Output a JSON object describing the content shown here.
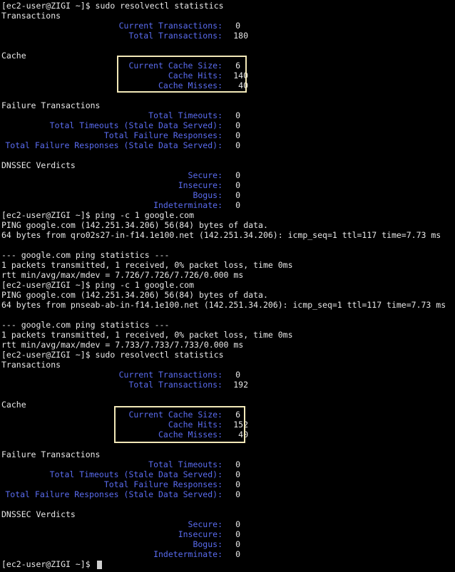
{
  "session1": {
    "prompt": "[ec2-user@ZIGI ~]$ sudo resolvectl statistics",
    "transactions": {
      "heading": "Transactions",
      "rows": [
        {
          "label": "Current Transactions:",
          "value": "0"
        },
        {
          "label": "Total Transactions:",
          "value": "180"
        }
      ]
    },
    "cache": {
      "heading": "Cache",
      "rows": [
        {
          "label": "Current Cache Size:",
          "value": "6"
        },
        {
          "label": "Cache Hits:",
          "value": "140"
        },
        {
          "label": "Cache Misses:",
          "value": "40"
        }
      ]
    },
    "failure": {
      "heading": "Failure Transactions",
      "rows": [
        {
          "label": "Total Timeouts:",
          "value": "0"
        },
        {
          "label": "Total Timeouts (Stale Data Served):",
          "value": "0"
        },
        {
          "label": "Total Failure Responses:",
          "value": "0"
        },
        {
          "label": "Total Failure Responses (Stale Data Served):",
          "value": "0"
        }
      ]
    },
    "dnssec": {
      "heading": "DNSSEC Verdicts",
      "rows": [
        {
          "label": "Secure:",
          "value": "0"
        },
        {
          "label": "Insecure:",
          "value": "0"
        },
        {
          "label": "Bogus:",
          "value": "0"
        },
        {
          "label": "Indeterminate:",
          "value": "0"
        }
      ]
    }
  },
  "ping1": {
    "prompt": "[ec2-user@ZIGI ~]$ ping -c 1 google.com",
    "line1": "PING google.com (142.251.34.206) 56(84) bytes of data.",
    "line2": "64 bytes from qro02s27-in-f14.1e100.net (142.251.34.206): icmp_seq=1 ttl=117 time=7.73 ms",
    "stats_header": "--- google.com ping statistics ---",
    "stats1": "1 packets transmitted, 1 received, 0% packet loss, time 0ms",
    "stats2": "rtt min/avg/max/mdev = 7.726/7.726/7.726/0.000 ms"
  },
  "ping2": {
    "prompt": "[ec2-user@ZIGI ~]$ ping -c 1 google.com",
    "line1": "PING google.com (142.251.34.206) 56(84) bytes of data.",
    "line2": "64 bytes from pnseab-ab-in-f14.1e100.net (142.251.34.206): icmp_seq=1 ttl=117 time=7.73 ms",
    "stats_header": "--- google.com ping statistics ---",
    "stats1": "1 packets transmitted, 1 received, 0% packet loss, time 0ms",
    "stats2": "rtt min/avg/max/mdev = 7.733/7.733/7.733/0.000 ms"
  },
  "session2": {
    "prompt": "[ec2-user@ZIGI ~]$ sudo resolvectl statistics",
    "transactions": {
      "heading": "Transactions",
      "rows": [
        {
          "label": "Current Transactions:",
          "value": "0"
        },
        {
          "label": "Total Transactions:",
          "value": "192"
        }
      ]
    },
    "cache": {
      "heading": "Cache",
      "rows": [
        {
          "label": "Current Cache Size:",
          "value": "6"
        },
        {
          "label": "Cache Hits:",
          "value": "152"
        },
        {
          "label": "Cache Misses:",
          "value": "40"
        }
      ]
    },
    "failure": {
      "heading": "Failure Transactions",
      "rows": [
        {
          "label": "Total Timeouts:",
          "value": "0"
        },
        {
          "label": "Total Timeouts (Stale Data Served):",
          "value": "0"
        },
        {
          "label": "Total Failure Responses:",
          "value": "0"
        },
        {
          "label": "Total Failure Responses (Stale Data Served):",
          "value": "0"
        }
      ]
    },
    "dnssec": {
      "heading": "DNSSEC Verdicts",
      "rows": [
        {
          "label": "Secure:",
          "value": "0"
        },
        {
          "label": "Insecure:",
          "value": "0"
        },
        {
          "label": "Bogus:",
          "value": "0"
        },
        {
          "label": "Indeterminate:",
          "value": "0"
        }
      ]
    }
  },
  "final_prompt": "[ec2-user@ZIGI ~]$ ",
  "colors": {
    "background": "#000000",
    "text": "#e8e8e8",
    "label_blue": "#5a6cf0",
    "highlight_box": "#f2e8b8"
  }
}
